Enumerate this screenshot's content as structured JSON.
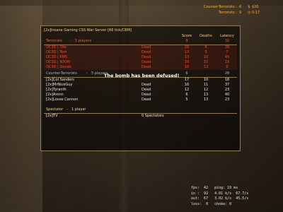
{
  "hud": {
    "ct_label": "Counter-Terrorists :",
    "ct_score": "6",
    "t_label": "Terrorists :",
    "t_score": "9",
    "money_icon": "dollar-icon",
    "money": "$30",
    "timer_icon": "clock-icon",
    "timer": "0:17"
  },
  "board": {
    "title": "[2x]Insane Gaming CSS War Server [66 tick/CBM]",
    "col_score": "Score",
    "col_deaths": "Deaths",
    "col_latency": "Latency",
    "terrorists": {
      "label": "Terrorists",
      "count": "5 players",
      "score": "9",
      "latency": "32",
      "players": [
        {
          "name": "OC3D | 3lfe",
          "status": "Dead",
          "score": "20",
          "deaths": "9",
          "latency": "39"
        },
        {
          "name": "OC3D | Tom",
          "status": "Dead",
          "score": "13",
          "deaths": "9",
          "latency": "7"
        },
        {
          "name": "OC3D | KMS",
          "status": "Dead",
          "score": "13",
          "deaths": "10",
          "latency": "45"
        },
        {
          "name": "OC3D | N3ON",
          "status": "Dead",
          "score": "10",
          "deaths": "10",
          "latency": "19"
        },
        {
          "name": "OC3D | Daveb",
          "status": "Dead",
          "score": "10",
          "deaths": "13",
          "latency": "9"
        }
      ]
    },
    "counter_terrorists": {
      "label": "Counter-Terrorists",
      "count": "5 players",
      "score": "6",
      "latency": "28",
      "players": [
        {
          "name": "[2x]Col Sanders",
          "status": "",
          "score": "17",
          "deaths": "10",
          "latency": "18"
        },
        {
          "name": "[2x]MrNiceGuy",
          "status": "Dead",
          "score": "16",
          "deaths": "11",
          "latency": "37"
        },
        {
          "name": "[2x]Tyranth",
          "status": "Dead",
          "score": "12",
          "deaths": "12",
          "latency": "23"
        },
        {
          "name": "[2x]Aronn",
          "status": "Dead",
          "score": "6",
          "deaths": "13",
          "latency": "40"
        },
        {
          "name": "[2x]Loose Cannon",
          "status": "Dead",
          "score": "5",
          "deaths": "13",
          "latency": "23"
        }
      ]
    },
    "spectators": {
      "label": "Spectator",
      "count": "1 player",
      "players": [
        {
          "name": "[2x]TV",
          "status": "0 Spectators"
        }
      ]
    }
  },
  "message": "The bomb has been defused!",
  "netgraph": {
    "line1": "fps:  42   ping: 19 ms",
    "line2": "in :  92   4.01 k/s  67.7/s",
    "line3": "out:  67   3.02 k/s  45.5/s",
    "line4": "loss:  0   choke: 0"
  }
}
